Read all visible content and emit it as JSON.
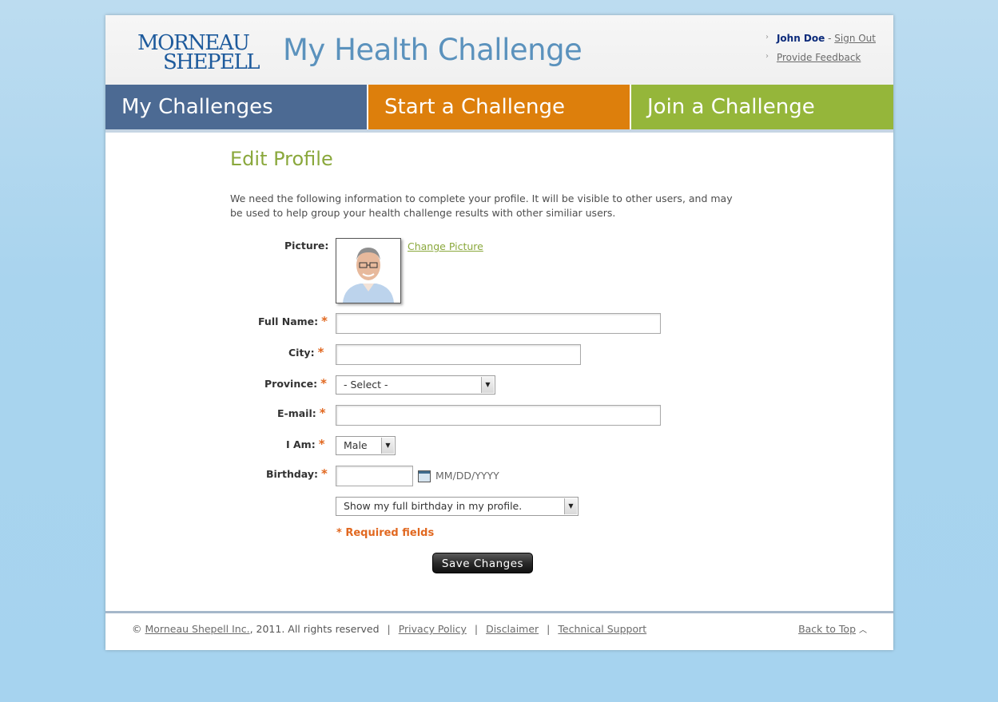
{
  "header": {
    "logo_line1": "MORNEAU",
    "logo_line2": "SHEPELL",
    "site_title": "My Health Challenge",
    "user_name": "John Doe",
    "sign_out": "Sign Out",
    "feedback": "Provide Feedback"
  },
  "nav": [
    {
      "label": "My Challenges",
      "color": "#4c6a93"
    },
    {
      "label": "Start a Challenge",
      "color": "#dd7f0c"
    },
    {
      "label": "Join a Challenge",
      "color": "#95b63a"
    }
  ],
  "main": {
    "title": "Edit Profile",
    "intro": "We need the following information to complete your profile. It will be visible to other users, and may be used to help group your health challenge results with other similiar users.",
    "picture_label": "Picture:",
    "change_picture": "Change Picture",
    "fields": {
      "full_name": {
        "label": "Full Name:",
        "value": ""
      },
      "city": {
        "label": "City:",
        "value": ""
      },
      "province": {
        "label": "Province:",
        "value": "- Select -"
      },
      "email": {
        "label": "E-mail:",
        "value": ""
      },
      "gender": {
        "label": "I Am:",
        "value": "Male"
      },
      "birthday": {
        "label": "Birthday:",
        "value": "",
        "hint": "MM/DD/YYYY"
      },
      "birthday_display": {
        "value": "Show my full birthday in my profile."
      }
    },
    "required_star": "*",
    "required_note": "Required fields",
    "save_button": "Save Changes"
  },
  "footer": {
    "copyright": "©",
    "company_link": "Morneau Shepell Inc.",
    "year_text": ", 2011. All rights reserved",
    "privacy": "Privacy Policy",
    "disclaimer": "Disclaimer",
    "support": "Technical Support",
    "back_to_top": "Back to Top"
  },
  "colors": {
    "accent_green": "#8aa83c",
    "required_orange": "#e16820"
  }
}
